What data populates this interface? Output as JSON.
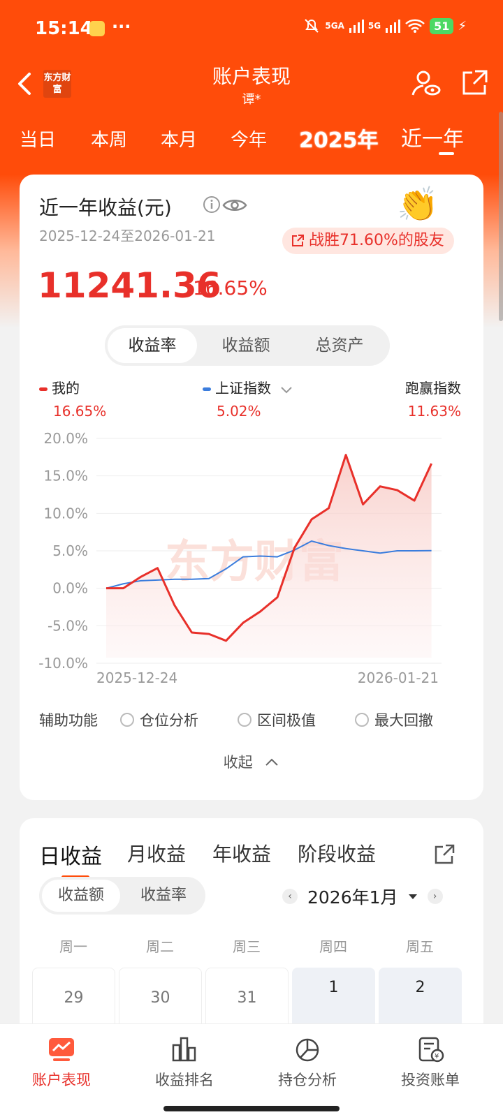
{
  "status_bar": {
    "time": "15:14",
    "dots": "···",
    "net1": "5GA",
    "net2": "5G",
    "battery": "51"
  },
  "nav": {
    "back": "<",
    "logo": "东方财富",
    "title": "账户表现",
    "subtitle": "谭*"
  },
  "period_tabs": [
    "当日",
    "本周",
    "本月",
    "今年",
    "2025年",
    "近一年"
  ],
  "card": {
    "title": "近一年收益(元)",
    "date_range": "2025-12-24至2026-01-21",
    "beat_badge": "战胜71.60%的股友",
    "profit_amount": "11241.36",
    "profit_rate": "16.65%",
    "segments": [
      "收益率",
      "收益额",
      "总资产"
    ],
    "legend": {
      "mine": {
        "label": "我的",
        "value": "16.65%",
        "color": "#e8302a"
      },
      "index": {
        "label": "上证指数",
        "value": "5.02%",
        "color": "#3b7ddd"
      },
      "beat": {
        "label": "跑赢指数",
        "value": "11.63%"
      }
    },
    "aux_label": "辅助功能",
    "aux_options": [
      "仓位分析",
      "区间极值",
      "最大回撤"
    ],
    "collapse_label": "收起"
  },
  "chart_data": {
    "type": "line",
    "watermark": "东方财富",
    "x_start_label": "2025-12-24",
    "x_end_label": "2026-01-21",
    "y_ticks": [
      "20.0%",
      "15.0%",
      "10.0%",
      "5.0%",
      "0.0%",
      "-5.0%",
      "-10.0%"
    ],
    "ylim": [
      -10,
      20
    ],
    "x": [
      "2025-12-24",
      "2025-12-25",
      "2025-12-26",
      "2025-12-29",
      "2025-12-30",
      "2025-12-31",
      "2026-01-02",
      "2026-01-05",
      "2026-01-06",
      "2026-01-07",
      "2026-01-08",
      "2026-01-09",
      "2026-01-12",
      "2026-01-13",
      "2026-01-14",
      "2026-01-15",
      "2026-01-16",
      "2026-01-19",
      "2026-01-20",
      "2026-01-21"
    ],
    "series": [
      {
        "name": "我的",
        "color": "#e8302a",
        "values": [
          0.0,
          0.0,
          1.5,
          2.7,
          -2.3,
          -5.9,
          -6.1,
          -7.0,
          -4.6,
          -3.1,
          -1.2,
          5.4,
          9.2,
          10.7,
          17.8,
          11.2,
          13.6,
          13.1,
          11.7,
          16.65
        ]
      },
      {
        "name": "上证指数",
        "color": "#3b7ddd",
        "values": [
          0.0,
          0.6,
          1.0,
          1.1,
          1.2,
          1.2,
          1.3,
          2.6,
          4.2,
          4.3,
          4.2,
          5.1,
          6.3,
          5.7,
          5.3,
          5.0,
          4.7,
          5.0,
          5.0,
          5.02
        ]
      }
    ]
  },
  "returns": {
    "tabs": [
      "日收益",
      "月收益",
      "年收益",
      "阶段收益"
    ],
    "segments": [
      "收益额",
      "收益率"
    ],
    "month": "2026年1月",
    "weekdays": [
      "周一",
      "周二",
      "周三",
      "周四",
      "周五"
    ],
    "days": [
      "29",
      "30",
      "31",
      "1",
      "2"
    ]
  },
  "bottom_nav": [
    "账户表现",
    "收益排名",
    "持仓分析",
    "投资账单"
  ]
}
